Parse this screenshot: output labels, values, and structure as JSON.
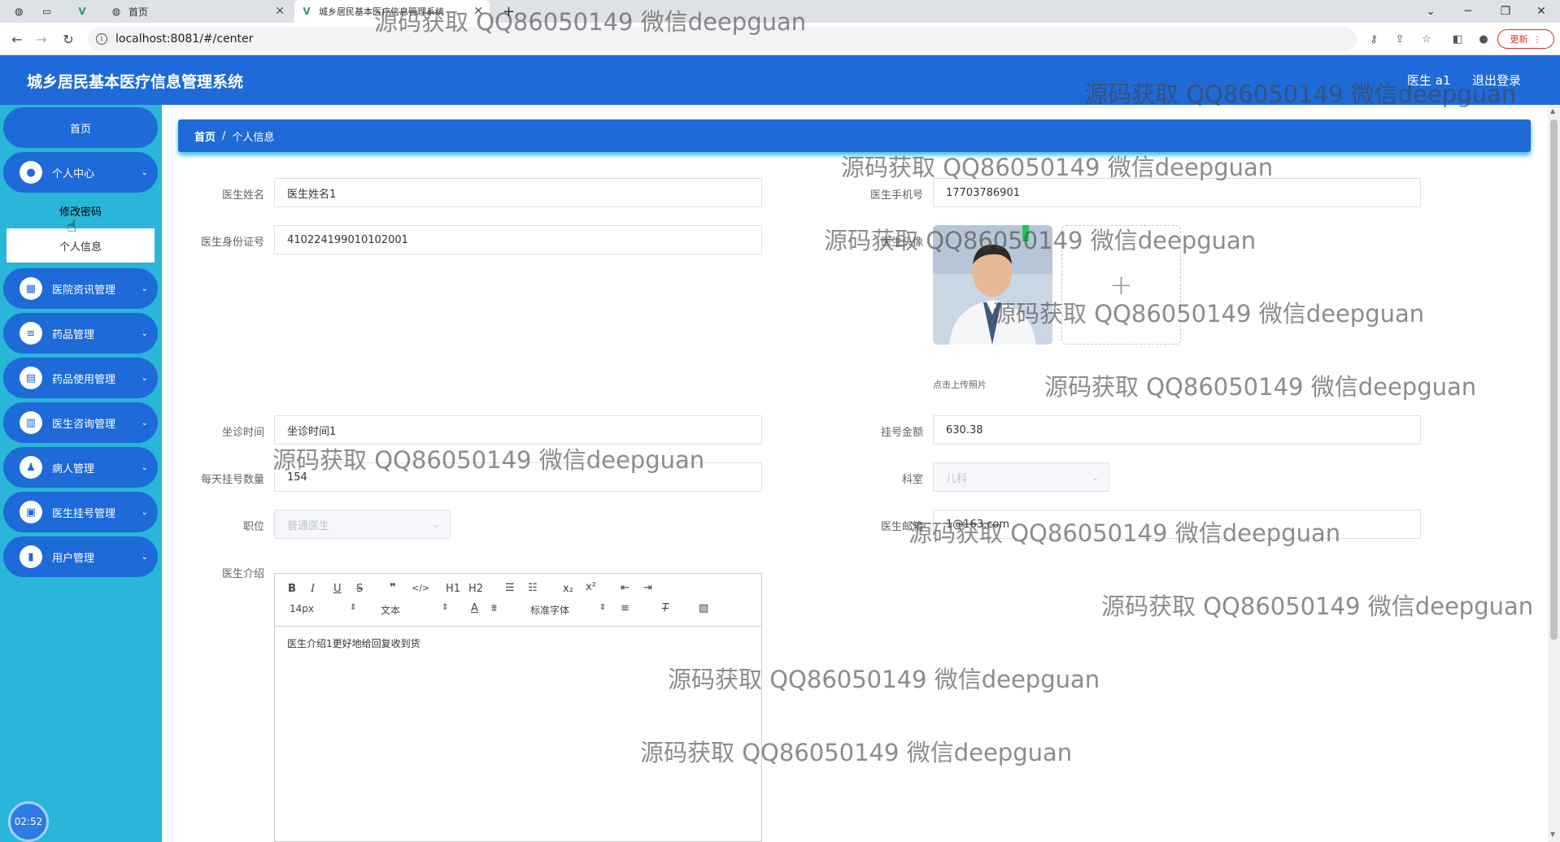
{
  "browser": {
    "tabs": [
      {
        "label": ""
      },
      {
        "label": ""
      },
      {
        "label": ""
      },
      {
        "label": "首页"
      },
      {
        "label": "城乡居民基本医疗信息管理系统"
      }
    ],
    "new_tab": "+",
    "url": "localhost:8081/#/center",
    "update_label": "更新"
  },
  "header": {
    "title": "城乡居民基本医疗信息管理系统",
    "user": "医生 a1",
    "logout": "退出登录"
  },
  "sidebar": {
    "home": "首页",
    "items": [
      {
        "label": "个人中心",
        "icon": "user-icon"
      },
      {
        "label": "医院资讯管理",
        "icon": "grid-icon"
      },
      {
        "label": "药品管理",
        "icon": "list-icon"
      },
      {
        "label": "药品使用管理",
        "icon": "briefcase-icon"
      },
      {
        "label": "医生咨询管理",
        "icon": "chart-icon"
      },
      {
        "label": "病人管理",
        "icon": "person-icon"
      },
      {
        "label": "医生挂号管理",
        "icon": "clipboard-icon"
      },
      {
        "label": "用户管理",
        "icon": "bar-chart-icon"
      }
    ],
    "submenu": [
      "修改密码",
      "个人信息"
    ],
    "clock": "02:52"
  },
  "breadcrumb": {
    "home": "首页",
    "separator": "/",
    "current": "个人信息"
  },
  "form": {
    "doctor_name_label": "医生姓名",
    "doctor_name": "医生姓名1",
    "phone_label": "医生手机号",
    "phone": "17703786901",
    "id_card_label": "医生身份证号",
    "id_card": "410224199010102001",
    "photo_label": "医生头像",
    "upload_hint": "点击上传照片",
    "upload_plus": "+",
    "schedule_label": "坐诊时间",
    "schedule": "坐诊时间1",
    "fee_label": "挂号金额",
    "fee": "630.38",
    "daily_quota_label": "每天挂号数量",
    "daily_quota": "154",
    "department_label": "科室",
    "department": "儿科",
    "position_label": "职位",
    "position": "普通医生",
    "email_label": "医生邮箱",
    "email": "1@163.com",
    "intro_label": "医生介绍",
    "intro": "医生介绍1更好地给回复收到货"
  },
  "editor_toolbar": {
    "size": "14px",
    "format": "文本",
    "font": "标准字体",
    "h1": "H1",
    "h2": "H2",
    "sub": "x₂",
    "sup": "x²"
  },
  "watermark": "源码获取 QQ86050149 微信deepguan"
}
